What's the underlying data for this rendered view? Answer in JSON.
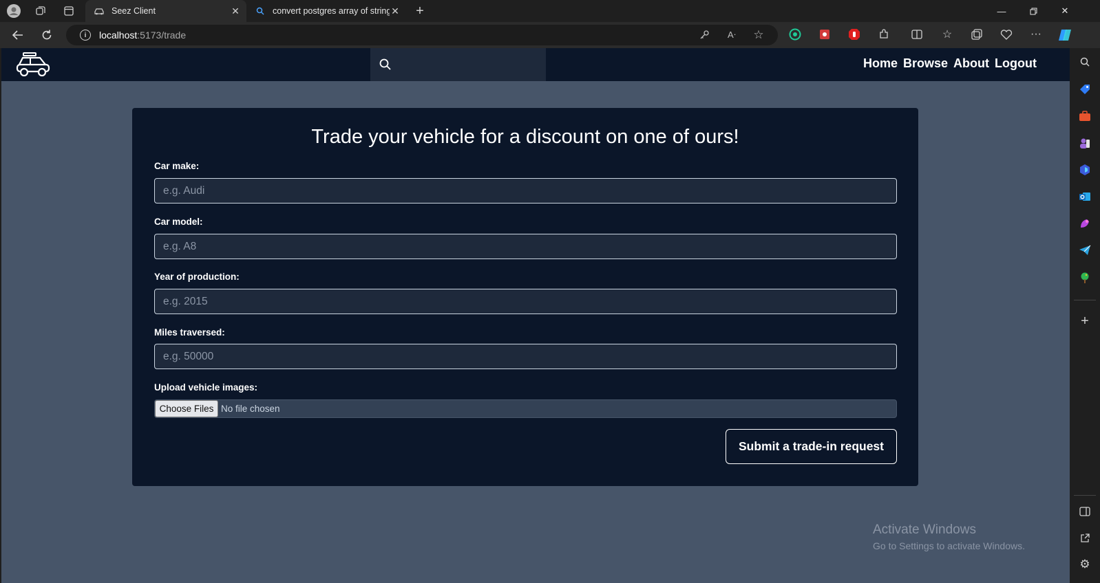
{
  "browser": {
    "tabs": [
      {
        "title": "Seez Client",
        "active": true
      },
      {
        "title": "convert postgres array of strings",
        "active": false
      }
    ],
    "url_host": "localhost",
    "url_path": ":5173/trade"
  },
  "header": {
    "nav_links": [
      "Home",
      "Browse",
      "About",
      "Logout"
    ]
  },
  "form": {
    "title": "Trade your vehicle for a discount on one of ours!",
    "fields": [
      {
        "label": "Car make:",
        "placeholder": "e.g. Audi"
      },
      {
        "label": "Car model:",
        "placeholder": "e.g. A8"
      },
      {
        "label": "Year of production:",
        "placeholder": "e.g. 2015"
      },
      {
        "label": "Miles traversed:",
        "placeholder": "e.g. 50000"
      }
    ],
    "upload_label": "Upload vehicle images:",
    "choose_files": "Choose Files",
    "file_status": "No file chosen",
    "submit": "Submit a trade-in request"
  },
  "watermark": {
    "line1": "Activate Windows",
    "line2": "Go to Settings to activate Windows."
  },
  "colors": {
    "nav_bg": "#0b1629",
    "page_bg": "#475569",
    "input_bg": "#1e293b"
  }
}
